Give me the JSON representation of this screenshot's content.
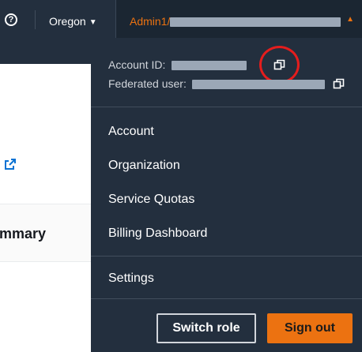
{
  "topbar": {
    "help_icon": "question-circle-icon",
    "help_glyph": "?",
    "region_label": "Oregon",
    "region_caret": "▼",
    "account_label_prefix": "Admin1/",
    "account_caret": "▲"
  },
  "background_page": {
    "section_heading": "mmary",
    "external_link_icon": "external-link-icon"
  },
  "menu": {
    "account_id_label": "Account ID:",
    "federated_user_label": "Federated user:",
    "copy_icon": "copy-icon",
    "items": [
      {
        "label": "Account"
      },
      {
        "label": "Organization"
      },
      {
        "label": "Service Quotas"
      },
      {
        "label": "Billing Dashboard"
      },
      {
        "label": "Settings"
      }
    ],
    "switch_role_label": "Switch role",
    "sign_out_label": "Sign out"
  },
  "colors": {
    "nav_bg": "#232f3e",
    "accent_orange": "#ec7211",
    "annotation_red": "#e41d1d",
    "link_blue": "#0972d3"
  }
}
